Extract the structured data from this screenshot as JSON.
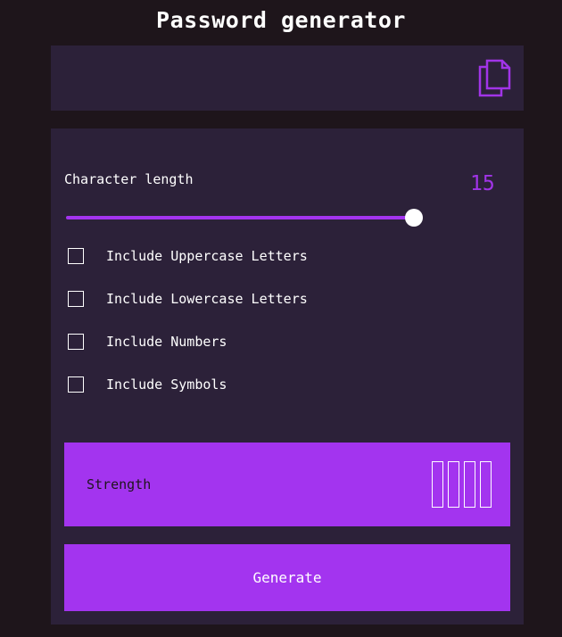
{
  "app": {
    "title": "Password generator"
  },
  "output": {
    "value": "",
    "copy_icon": "copy-icon"
  },
  "length": {
    "label": "Character length",
    "value": "15",
    "slider_fraction": 0.975
  },
  "options": [
    {
      "label": "Include Uppercase Letters",
      "checked": false
    },
    {
      "label": "Include Lowercase Letters",
      "checked": false
    },
    {
      "label": "Include Numbers",
      "checked": false
    },
    {
      "label": "Include Symbols",
      "checked": false
    }
  ],
  "strength": {
    "label": "Strength",
    "bars_filled": 0,
    "bars_total": 4
  },
  "generate": {
    "label": "Generate"
  },
  "colors": {
    "accent": "#a334ef",
    "panel": "#2c2139",
    "background": "#1e151b"
  }
}
